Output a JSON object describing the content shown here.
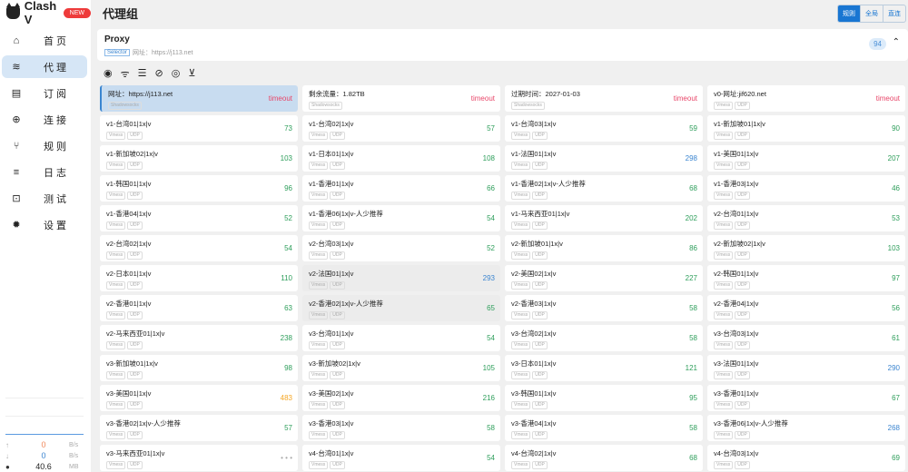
{
  "app": {
    "name": "Clash V",
    "badge": "NEW"
  },
  "sidebar": {
    "items": [
      {
        "label": "首页",
        "icon": "home-icon",
        "glyph": "⌂"
      },
      {
        "label": "代理",
        "icon": "wifi-icon",
        "glyph": "≋",
        "active": true
      },
      {
        "label": "订阅",
        "icon": "server-icon",
        "glyph": "▤"
      },
      {
        "label": "连接",
        "icon": "globe-icon",
        "glyph": "⊕"
      },
      {
        "label": "规则",
        "icon": "fork-icon",
        "glyph": "⑂"
      },
      {
        "label": "日志",
        "icon": "list-icon",
        "glyph": "≡"
      },
      {
        "label": "测试",
        "icon": "lock-icon",
        "glyph": "⊡"
      },
      {
        "label": "设置",
        "icon": "gear-icon",
        "glyph": "✹"
      }
    ]
  },
  "traffic": {
    "up": "0",
    "up_unit": "B/s",
    "down": "0",
    "down_unit": "B/s",
    "mem": "40.6",
    "mem_unit": "MB"
  },
  "header": {
    "title": "代理组",
    "modes": [
      "规则",
      "全局",
      "直连"
    ]
  },
  "group": {
    "name": "Proxy",
    "type": "Selector",
    "url": "网址：https://j113.net",
    "count": "94"
  },
  "tools": [
    "locate-icon",
    "wifi-check-icon",
    "sort-icon",
    "no-signal-icon",
    "eye-icon",
    "filter-off-icon"
  ],
  "proxies": [
    {
      "name": "网址：https://j113.net",
      "tags": [
        "Shadowsocks"
      ],
      "delay": "timeout",
      "selected": true
    },
    {
      "name": "剩余流量：1.82TB",
      "tags": [
        "Shadowsocks"
      ],
      "delay": "timeout"
    },
    {
      "name": "过期时间：2027-01-03",
      "tags": [
        "Shadowsocks"
      ],
      "delay": "timeout"
    },
    {
      "name": "v0-网址:jif620.net",
      "tags": [
        "Vmess",
        "UDP"
      ],
      "delay": "timeout"
    },
    {
      "name": "v1-台湾01|1x|v",
      "tags": [
        "Vmess",
        "UDP"
      ],
      "delay": "73"
    },
    {
      "name": "v1-台湾02|1x|v",
      "tags": [
        "Vmess",
        "UDP"
      ],
      "delay": "57"
    },
    {
      "name": "v1-台湾03|1x|v",
      "tags": [
        "Vmess",
        "UDP"
      ],
      "delay": "59"
    },
    {
      "name": "v1-新加坡01|1x|v",
      "tags": [
        "Vmess",
        "UDP"
      ],
      "delay": "90"
    },
    {
      "name": "v1-新加坡02|1x|v",
      "tags": [
        "Vmess",
        "UDP"
      ],
      "delay": "103"
    },
    {
      "name": "v1-日本01|1x|v",
      "tags": [
        "Vmess",
        "UDP"
      ],
      "delay": "108"
    },
    {
      "name": "v1-法国01|1x|v",
      "tags": [
        "Vmess",
        "UDP"
      ],
      "delay": "298"
    },
    {
      "name": "v1-美国01|1x|v",
      "tags": [
        "Vmess",
        "UDP"
      ],
      "delay": "207"
    },
    {
      "name": "v1-韩国01|1x|v",
      "tags": [
        "Vmess",
        "UDP"
      ],
      "delay": "96"
    },
    {
      "name": "v1-香港01|1x|v",
      "tags": [
        "Vmess",
        "UDP"
      ],
      "delay": "66"
    },
    {
      "name": "v1-香港02|1x|v-人少推荐",
      "tags": [
        "Vmess",
        "UDP"
      ],
      "delay": "68"
    },
    {
      "name": "v1-香港03|1x|v",
      "tags": [
        "Vmess",
        "UDP"
      ],
      "delay": "46"
    },
    {
      "name": "v1-香港04|1x|v",
      "tags": [
        "Vmess",
        "UDP"
      ],
      "delay": "52"
    },
    {
      "name": "v1-香港06|1x|v-人少推荐",
      "tags": [
        "Vmess",
        "UDP"
      ],
      "delay": "54"
    },
    {
      "name": "v1-马来西亚01|1x|v",
      "tags": [
        "Vmess",
        "UDP"
      ],
      "delay": "202"
    },
    {
      "name": "v2-台湾01|1x|v",
      "tags": [
        "Vmess",
        "UDP"
      ],
      "delay": "53"
    },
    {
      "name": "v2-台湾02|1x|v",
      "tags": [
        "Vmess",
        "UDP"
      ],
      "delay": "54"
    },
    {
      "name": "v2-台湾03|1x|v",
      "tags": [
        "Vmess",
        "UDP"
      ],
      "delay": "52"
    },
    {
      "name": "v2-新加坡01|1x|v",
      "tags": [
        "Vmess",
        "UDP"
      ],
      "delay": "86"
    },
    {
      "name": "v2-新加坡02|1x|v",
      "tags": [
        "Vmess",
        "UDP"
      ],
      "delay": "103"
    },
    {
      "name": "v2-日本01|1x|v",
      "tags": [
        "Vmess",
        "UDP"
      ],
      "delay": "110"
    },
    {
      "name": "v2-法国01|1x|v",
      "tags": [
        "Vmess",
        "UDP"
      ],
      "delay": "293",
      "hover": true
    },
    {
      "name": "v2-美国02|1x|v",
      "tags": [
        "Vmess",
        "UDP"
      ],
      "delay": "227"
    },
    {
      "name": "v2-韩国01|1x|v",
      "tags": [
        "Vmess",
        "UDP"
      ],
      "delay": "97"
    },
    {
      "name": "v2-香港01|1x|v",
      "tags": [
        "Vmess",
        "UDP"
      ],
      "delay": "63"
    },
    {
      "name": "v2-香港02|1x|v-人少推荐",
      "tags": [
        "Vmess",
        "UDP"
      ],
      "delay": "65",
      "hover": true
    },
    {
      "name": "v2-香港03|1x|v",
      "tags": [
        "Vmess",
        "UDP"
      ],
      "delay": "58"
    },
    {
      "name": "v2-香港04|1x|v",
      "tags": [
        "Vmess",
        "UDP"
      ],
      "delay": "56"
    },
    {
      "name": "v2-马来西亚01|1x|v",
      "tags": [
        "Vmess",
        "UDP"
      ],
      "delay": "238"
    },
    {
      "name": "v3-台湾01|1x|v",
      "tags": [
        "Vmess",
        "UDP"
      ],
      "delay": "54"
    },
    {
      "name": "v3-台湾02|1x|v",
      "tags": [
        "Vmess",
        "UDP"
      ],
      "delay": "58"
    },
    {
      "name": "v3-台湾03|1x|v",
      "tags": [
        "Vmess",
        "UDP"
      ],
      "delay": "61"
    },
    {
      "name": "v3-新加坡01|1x|v",
      "tags": [
        "Vmess",
        "UDP"
      ],
      "delay": "98"
    },
    {
      "name": "v3-新加坡02|1x|v",
      "tags": [
        "Vmess",
        "UDP"
      ],
      "delay": "105"
    },
    {
      "name": "v3-日本01|1x|v",
      "tags": [
        "Vmess",
        "UDP"
      ],
      "delay": "121"
    },
    {
      "name": "v3-法国01|1x|v",
      "tags": [
        "Vmess",
        "UDP"
      ],
      "delay": "290"
    },
    {
      "name": "v3-美国01|1x|v",
      "tags": [
        "Vmess",
        "UDP"
      ],
      "delay": "483"
    },
    {
      "name": "v3-美国02|1x|v",
      "tags": [
        "Vmess",
        "UDP"
      ],
      "delay": "216"
    },
    {
      "name": "v3-韩国01|1x|v",
      "tags": [
        "Vmess",
        "UDP"
      ],
      "delay": "95"
    },
    {
      "name": "v3-香港01|1x|v",
      "tags": [
        "Vmess",
        "UDP"
      ],
      "delay": "67"
    },
    {
      "name": "v3-香港02|1x|v-人少推荐",
      "tags": [
        "Vmess",
        "UDP"
      ],
      "delay": "57"
    },
    {
      "name": "v3-香港03|1x|v",
      "tags": [
        "Vmess",
        "UDP"
      ],
      "delay": "58"
    },
    {
      "name": "v3-香港04|1x|v",
      "tags": [
        "Vmess",
        "UDP"
      ],
      "delay": "58"
    },
    {
      "name": "v3-香港06|1x|v-人少推荐",
      "tags": [
        "Vmess",
        "UDP"
      ],
      "delay": "268"
    },
    {
      "name": "v3-马来西亚01|1x|v",
      "tags": [
        "Vmess",
        "UDP"
      ],
      "delay": "• • •"
    },
    {
      "name": "v4-台湾01|1x|v",
      "tags": [
        "Vmess",
        "UDP"
      ],
      "delay": "54"
    },
    {
      "name": "v4-台湾02|1x|v",
      "tags": [
        "Vmess",
        "UDP"
      ],
      "delay": "68"
    },
    {
      "name": "v4-台湾03|1x|v",
      "tags": [
        "Vmess",
        "UDP"
      ],
      "delay": "69"
    }
  ],
  "colors": {
    "good": "#2e9e5b",
    "mid": "#3b85d0",
    "slow": "#f5a623",
    "timeout": "#e8476a",
    "pending": "#aaaaaa"
  }
}
